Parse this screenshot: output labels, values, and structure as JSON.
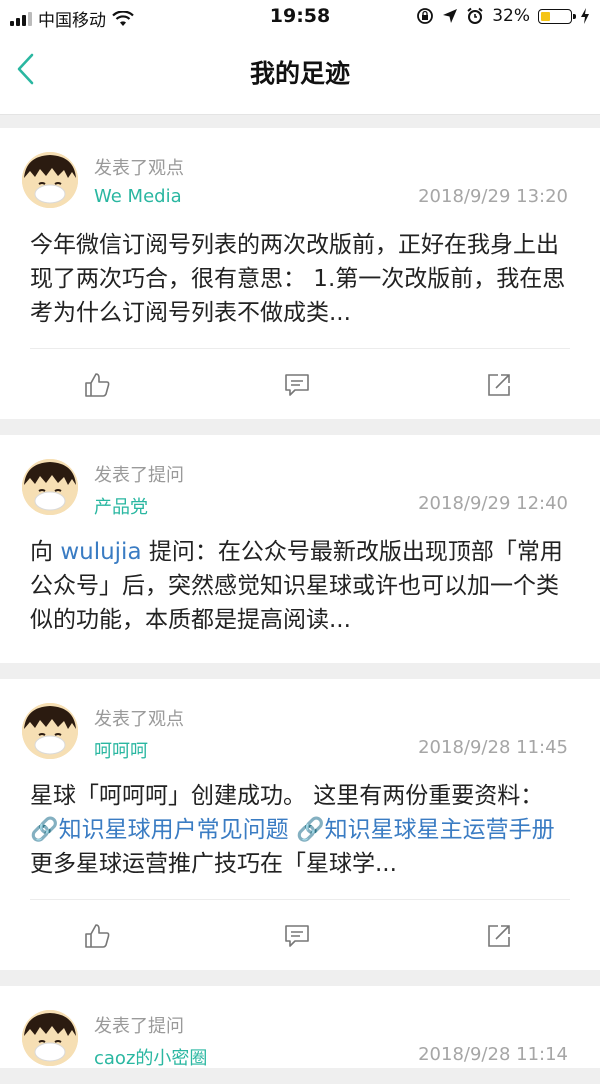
{
  "status_bar": {
    "carrier": "中国移动",
    "time": "19:58",
    "battery_percent": "32%",
    "battery_level": 0.32,
    "accent_yellow": "#f5c518"
  },
  "nav": {
    "title": "我的足迹",
    "back_icon": "chevron-left-icon",
    "accent": "#2ab7a1"
  },
  "feed": [
    {
      "action": "发表了观点",
      "circle": "We Media",
      "time": "2018/9/29 13:20",
      "content": "今年微信订阅号列表的两次改版前，正好在我身上出现了两次巧合，很有意思： 1.第一次改版前，我在思考为什么订阅号列表不做成类...",
      "has_actions": true
    },
    {
      "action": "发表了提问",
      "circle": "产品党",
      "time": "2018/9/29 12:40",
      "content_prefix": "向 ",
      "content_user": "wulujia",
      "content_rest": " 提问：在公众号最新改版出现顶部「常用公众号」后，突然感觉知识星球或许也可以加一个类似的功能，本质都是提高阅读...",
      "has_actions": false
    },
    {
      "action": "发表了观点",
      "circle": "呵呵呵",
      "time": "2018/9/28 11:45",
      "content_prefix": "星球「呵呵呵」创建成功。 这里有两份重要资料： ",
      "link1": "🔗知识星球用户常见问题",
      "link_sep": " ",
      "link2": "🔗知识星球星主运营手册",
      "content_rest": " 更多星球运营推广技巧在「星球学...",
      "has_actions": true
    },
    {
      "action": "发表了提问",
      "circle": "caoz的小密圈",
      "time": "2018/9/28 11:14"
    }
  ],
  "icons": {
    "like": "thumbs-up-icon",
    "comment": "comment-icon",
    "share": "share-icon"
  }
}
